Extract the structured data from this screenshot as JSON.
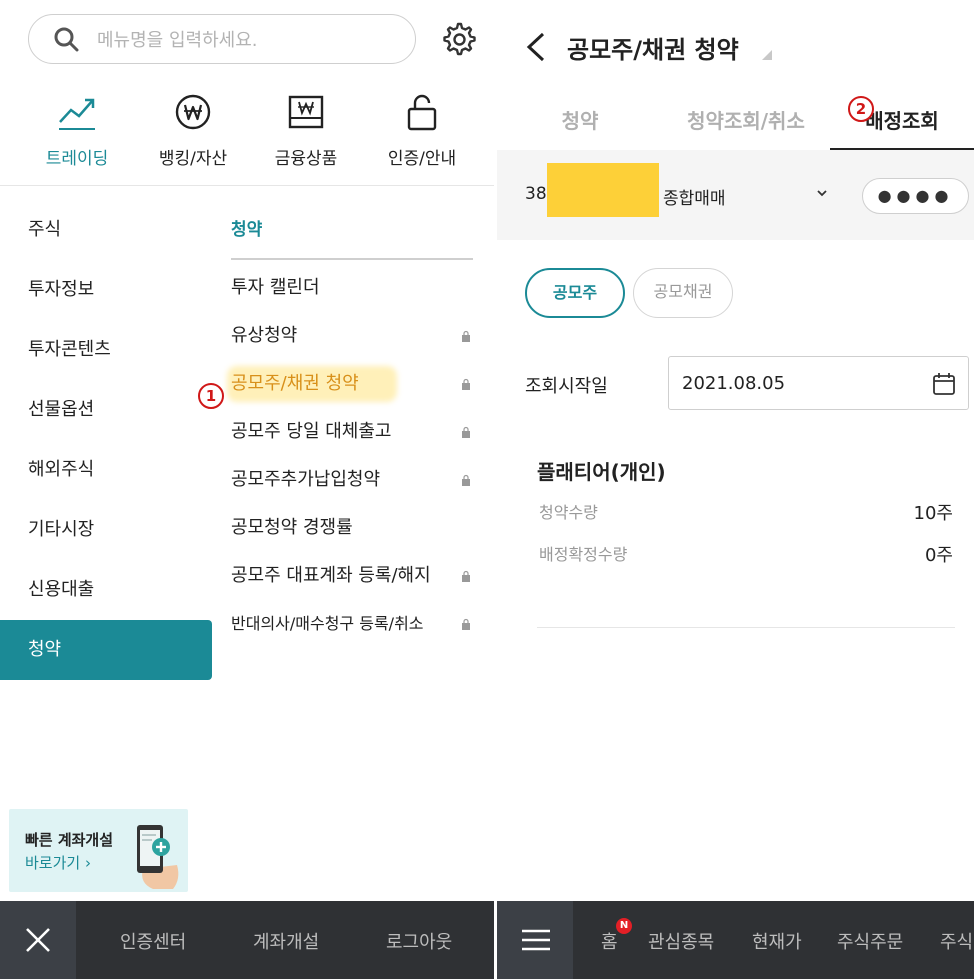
{
  "left": {
    "search": {
      "placeholder": "메뉴명을 입력하세요.",
      "icon": "search-icon"
    },
    "settings_icon": "gear-icon",
    "categories": [
      {
        "label": "트레이딩",
        "icon": "trend-chart-icon",
        "active": true
      },
      {
        "label": "뱅킹/자산",
        "icon": "won-coin-icon"
      },
      {
        "label": "금융상품",
        "icon": "won-bill-icon"
      },
      {
        "label": "인증/안내",
        "icon": "lock-icon"
      }
    ],
    "menu": [
      {
        "label": "주식"
      },
      {
        "label": "투자정보"
      },
      {
        "label": "투자콘텐츠"
      },
      {
        "label": "선물옵션"
      },
      {
        "label": "해외주식"
      },
      {
        "label": "기타시장"
      },
      {
        "label": "신용대출"
      },
      {
        "label": "청약",
        "active": true
      }
    ],
    "section_title": "청약",
    "submenu": [
      {
        "label": "투자 캘린더",
        "locked": false
      },
      {
        "label": "유상청약",
        "locked": true
      },
      {
        "label": "공모주/채권 청약",
        "locked": true,
        "highlighted": true
      },
      {
        "label": "공모주 당일 대체출고",
        "locked": true
      },
      {
        "label": "공모주추가납입청약",
        "locked": true
      },
      {
        "label": "공모청약 경쟁률",
        "locked": false
      },
      {
        "label": "공모주 대표계좌 등록/해지",
        "locked": true
      },
      {
        "label": "반대의사/매수청구 등록/취소",
        "locked": true
      }
    ],
    "step1": "1",
    "banner": {
      "title": "빠른 계좌개설",
      "link": "바로가기 ›"
    },
    "bottom": {
      "items": [
        "인증센터",
        "계좌개설",
        "로그아웃"
      ],
      "close_icon": "close-icon"
    }
  },
  "right": {
    "title": "공모주/채권 청약",
    "tabs": [
      "청약",
      "청약조회/취소",
      "배정조회"
    ],
    "active_tab": 2,
    "step2": "2",
    "account": {
      "prefix": "38",
      "type": "종합매매",
      "password": "●●●●"
    },
    "chips": [
      "공모주",
      "공모채권"
    ],
    "date": {
      "label": "조회시작일",
      "value": "2021.08.05"
    },
    "result": {
      "name": "플래티어(개인)",
      "rows": [
        {
          "label": "청약수량",
          "value": "10주"
        },
        {
          "label": "배정확정수량",
          "value": "0주"
        }
      ]
    },
    "bottom": {
      "items": [
        "홈",
        "관심종목",
        "현재가",
        "주식주문",
        "주식"
      ],
      "badge": "N"
    }
  },
  "colors": {
    "accent": "#1b8a96",
    "highlight": "#fdd038",
    "step": "#d01818",
    "bottom_bar": "#2f3134"
  }
}
